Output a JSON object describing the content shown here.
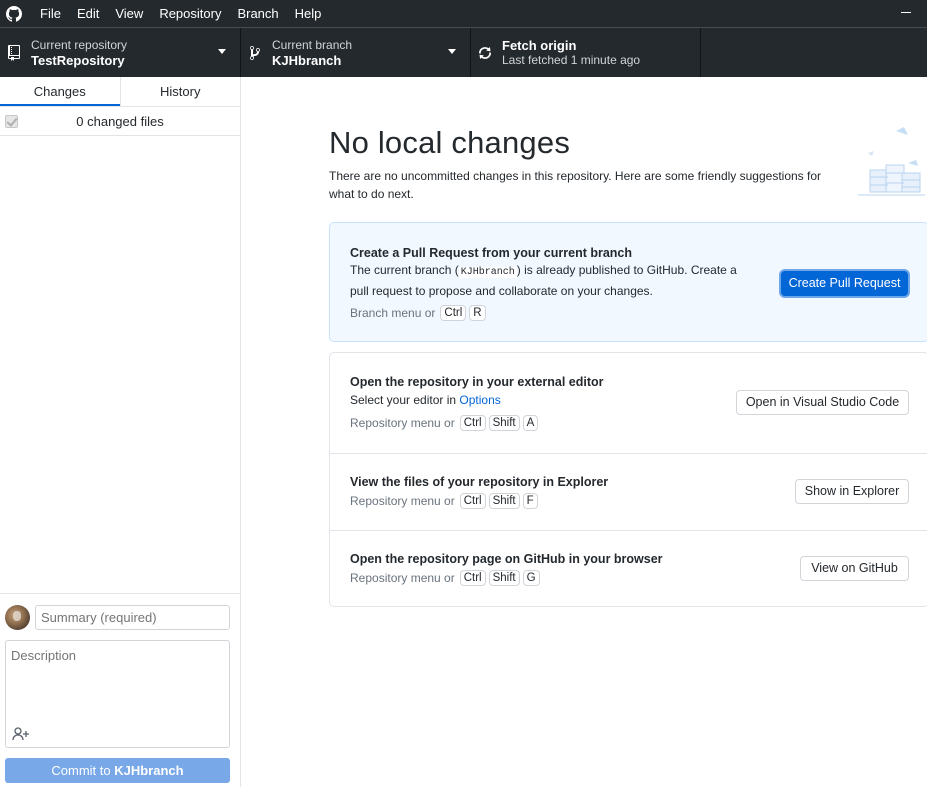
{
  "menu": [
    "File",
    "Edit",
    "View",
    "Repository",
    "Branch",
    "Help"
  ],
  "toolbar": {
    "repo_label": "Current repository",
    "repo_value": "TestRepository",
    "branch_label": "Current branch",
    "branch_value": "KJHbranch",
    "fetch_title": "Fetch origin",
    "fetch_sub": "Last fetched 1 minute ago"
  },
  "sidebar": {
    "tabs": [
      {
        "label": "Changes"
      },
      {
        "label": "History"
      }
    ],
    "changed_files": "0 changed files",
    "summary_placeholder": "Summary (required)",
    "description_placeholder": "Description",
    "commit_prefix": "Commit to ",
    "commit_branch": "KJHbranch"
  },
  "main": {
    "title": "No local changes",
    "subtitle": "There are no uncommitted changes in this repository. Here are some friendly suggestions for what to do next.",
    "pr": {
      "title": "Create a Pull Request from your current branch",
      "desc_before": "The current branch (",
      "desc_code": "KJHbranch",
      "desc_after_line1": ") is already published to GitHub. Create a",
      "desc_line2": "pull request to propose and collaborate on your changes.",
      "shortcut_prefix": "Branch menu or",
      "keys": [
        "Ctrl",
        "R"
      ],
      "button": "Create Pull Request"
    },
    "editor": {
      "title": "Open the repository in your external editor",
      "desc_prefix": "Select your editor in ",
      "desc_link": "Options",
      "shortcut_prefix": "Repository menu or",
      "keys": [
        "Ctrl",
        "Shift",
        "A"
      ],
      "button": "Open in Visual Studio Code"
    },
    "explorer": {
      "title": "View the files of your repository in Explorer",
      "shortcut_prefix": "Repository menu or",
      "keys": [
        "Ctrl",
        "Shift",
        "F"
      ],
      "button": "Show in Explorer"
    },
    "github": {
      "title": "Open the repository page on GitHub in your browser",
      "shortcut_prefix": "Repository menu or",
      "keys": [
        "Ctrl",
        "Shift",
        "G"
      ],
      "button": "View on GitHub"
    }
  },
  "colors": {
    "titlebar": "#24292e",
    "accent": "#0366d6",
    "pr_card_bg": "#f1f8ff",
    "commit_disabled": "#79a8e8"
  }
}
